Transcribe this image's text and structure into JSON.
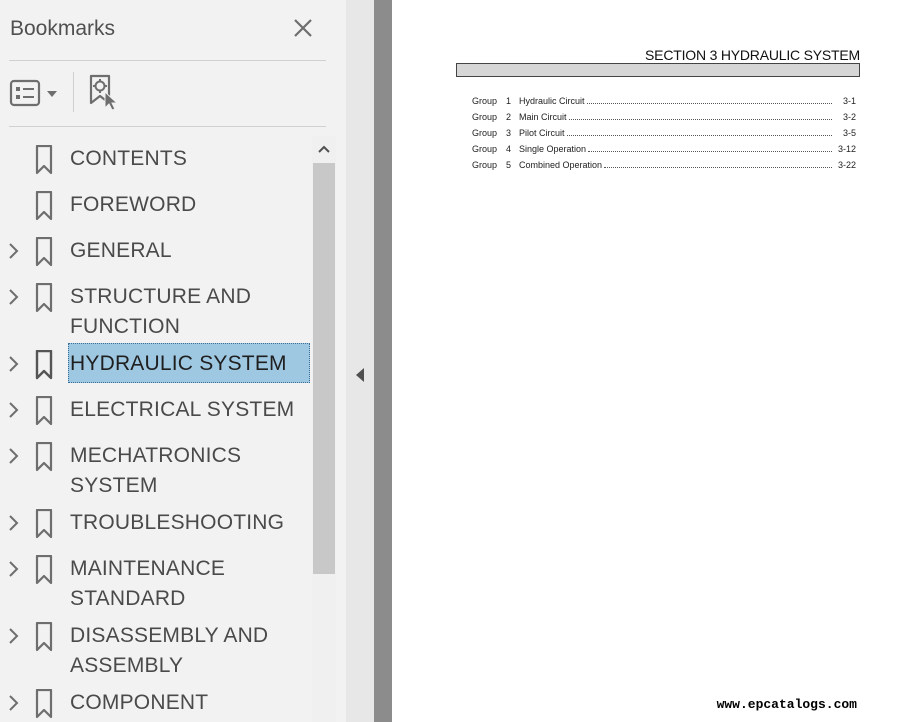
{
  "panel": {
    "title": "Bookmarks",
    "items": [
      {
        "label": "CONTENTS",
        "expandable": false,
        "selected": false
      },
      {
        "label": "FOREWORD",
        "expandable": false,
        "selected": false
      },
      {
        "label": "GENERAL",
        "expandable": true,
        "selected": false
      },
      {
        "label": "STRUCTURE AND FUNCTION",
        "expandable": true,
        "selected": false
      },
      {
        "label": "HYDRAULIC SYSTEM",
        "expandable": true,
        "selected": true
      },
      {
        "label": "ELECTRICAL SYSTEM",
        "expandable": true,
        "selected": false
      },
      {
        "label": "MECHATRONICS SYSTEM",
        "expandable": true,
        "selected": false
      },
      {
        "label": "TROUBLESHOOTING",
        "expandable": true,
        "selected": false
      },
      {
        "label": "MAINTENANCE STANDARD",
        "expandable": true,
        "selected": false
      },
      {
        "label": "DISASSEMBLY AND ASSEMBLY",
        "expandable": true,
        "selected": false
      },
      {
        "label": "COMPONENT",
        "expandable": true,
        "selected": false
      }
    ],
    "icons": {
      "close": "close-icon",
      "options": "bookmark-options-icon",
      "find": "find-current-bookmark-icon",
      "bookmark": "bookmark-icon",
      "expand": "chevron-right-icon",
      "scroll_up": "chevron-up-icon",
      "collapse": "triangle-left-icon"
    }
  },
  "document": {
    "section_title": "SECTION  3  HYDRAULIC SYSTEM",
    "toc": [
      {
        "group": "Group",
        "number": "1",
        "name": "Hydraulic Circuit",
        "page": "3-1"
      },
      {
        "group": "Group",
        "number": "2",
        "name": "Main Circuit",
        "page": "3-2"
      },
      {
        "group": "Group",
        "number": "3",
        "name": "Pilot Circuit",
        "page": "3-5"
      },
      {
        "group": "Group",
        "number": "4",
        "name": "Single Operation",
        "page": "3-12"
      },
      {
        "group": "Group",
        "number": "5",
        "name": "Combined Operation",
        "page": "3-22"
      }
    ],
    "watermark": "www.epcatalogs.com"
  },
  "colors": {
    "panel_bg": "#f2f2f2",
    "selection": "#9ec7e2",
    "icon_gray": "#6e6e6e",
    "page_gutter": "#8c8c8c"
  }
}
